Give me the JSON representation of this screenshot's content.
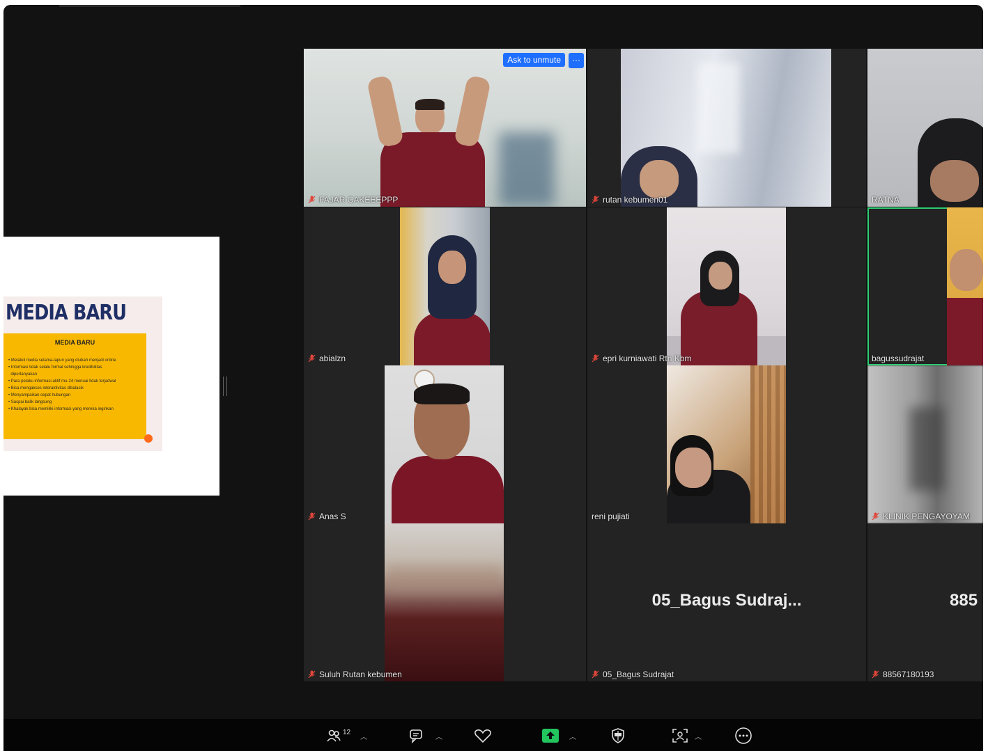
{
  "slide": {
    "title": "MEDIA BARU",
    "box_title": "MEDIA BARU",
    "bullets": [
      "Melaluli media selama-lapun yang diubah menjadi online",
      "Informasi tidak selalu formal sehingga kredibilitas",
      "dipertanyakan",
      "Para pelaku informasi aktif mu-24 menuai tidak terjadwal",
      "Bisa mengakses interaktivitas dibalasik",
      "Menyampaikan cepat hubungan",
      "Saspai balik langsung",
      "Khalayak bisa memiliki informasi yang mereka inginkan"
    ]
  },
  "controls": {
    "ask_to_unmute": "Ask to unmute",
    "more": "···"
  },
  "participants": [
    {
      "name": "FAJAR CAKEEEPPP",
      "muted": true
    },
    {
      "name": "rutan kebumen01",
      "muted": true
    },
    {
      "name": "RATNA",
      "muted": false
    },
    {
      "name": "abialzn",
      "muted": true
    },
    {
      "name": "epri kurniawati Rtn Kbm",
      "muted": true
    },
    {
      "name": "bagussudrajat",
      "muted": false
    },
    {
      "name": "Anas S",
      "muted": true
    },
    {
      "name": "reni pujiati",
      "muted": false
    },
    {
      "name": "KLINIK PENGAYOYAM",
      "muted": true
    },
    {
      "name": "Suluh Rutan kebumen",
      "muted": true
    },
    {
      "name": "05_Bagus Sudrajat",
      "muted": true,
      "display_name": "05_Bagus  Sudraj..."
    },
    {
      "name": "88567180193",
      "muted": true,
      "display_name": "885"
    }
  ],
  "toolbar": {
    "participants_count": "12"
  },
  "colors": {
    "background": "#121212",
    "tile": "#232323",
    "accent_blue": "#1f6fff",
    "active_speaker": "#2ecc71",
    "muted_red": "#e0463a",
    "share_green": "#22c55e"
  }
}
